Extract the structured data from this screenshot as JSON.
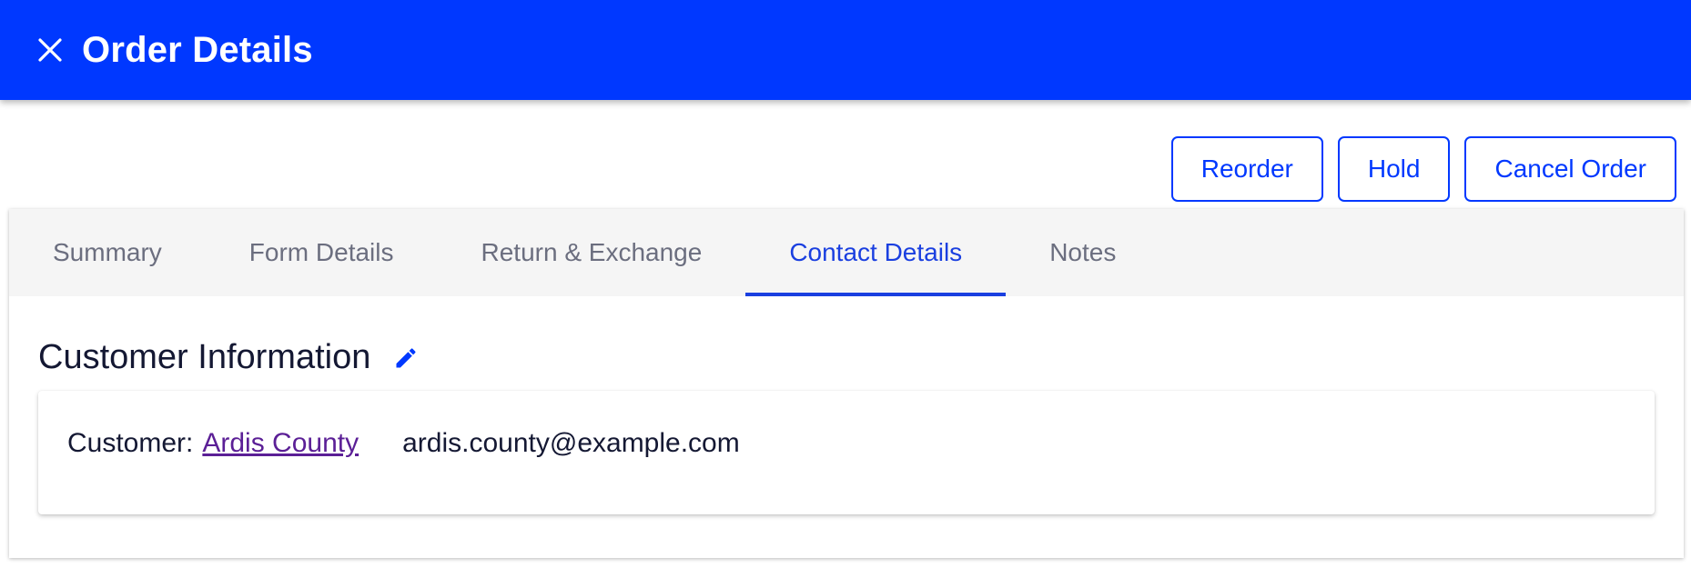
{
  "colors": {
    "brand": "#0038ff",
    "tab_active": "#1a3fe0",
    "tab_inactive": "#6b6e7f",
    "link_visited": "#5b1f96",
    "text_dark": "#141833"
  },
  "header": {
    "title": "Order Details",
    "close_icon": "close-icon"
  },
  "actions": {
    "reorder_label": "Reorder",
    "hold_label": "Hold",
    "cancel_label": "Cancel Order"
  },
  "tabs": [
    {
      "label": "Summary",
      "active": false
    },
    {
      "label": "Form Details",
      "active": false
    },
    {
      "label": "Return & Exchange",
      "active": false
    },
    {
      "label": "Contact Details",
      "active": true
    },
    {
      "label": "Notes",
      "active": false
    }
  ],
  "customer_info": {
    "title": "Customer Information",
    "edit_icon": "pencil-icon",
    "customer_label": "Customer:",
    "customer_name": "Ardis County",
    "email": "ardis.county@example.com"
  }
}
